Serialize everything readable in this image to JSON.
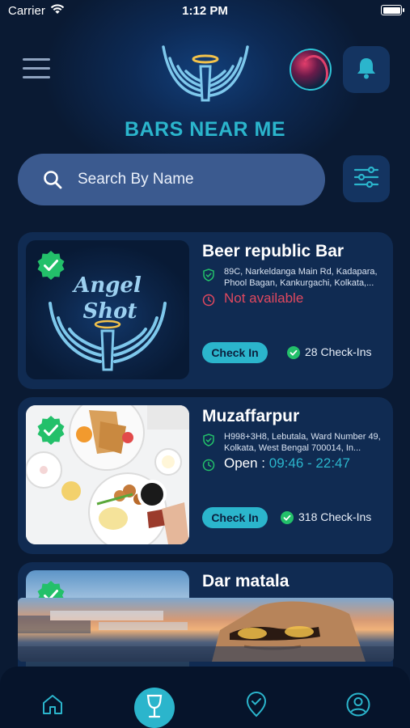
{
  "status_bar": {
    "carrier": "Carrier",
    "time": "1:12 PM"
  },
  "header": {
    "title": "BARS NEAR ME"
  },
  "search": {
    "placeholder": "Search By Name"
  },
  "bars": [
    {
      "name": "Beer republic Bar",
      "address": "89C, Narkeldanga Main Rd, Kadapara, Phool Bagan, Kankurgachi, Kolkata,...",
      "availability": "Not available",
      "checkin_label": "Check In",
      "checkins": "28 Check-Ins",
      "thumbnail_text": [
        "Angel",
        "Shot"
      ]
    },
    {
      "name": "Muzaffarpur",
      "address": "H998+3H8, Lebutala, Ward Number 49, Kolkata, West Bengal 700014, In...",
      "open_label": "Open : ",
      "open_hours": "09:46 - 22:47",
      "checkin_label": "Check In",
      "checkins": "318 Check-Ins"
    },
    {
      "name": "Dar matala"
    }
  ],
  "bottom_nav": [
    "home-icon",
    "wine-glass-icon",
    "location-check-icon",
    "profile-icon"
  ],
  "colors": {
    "accent": "#2bb5cc",
    "background": "#0a1a33",
    "card": "#102b52",
    "verified": "#23c06a",
    "unavailable": "#e0485f"
  }
}
